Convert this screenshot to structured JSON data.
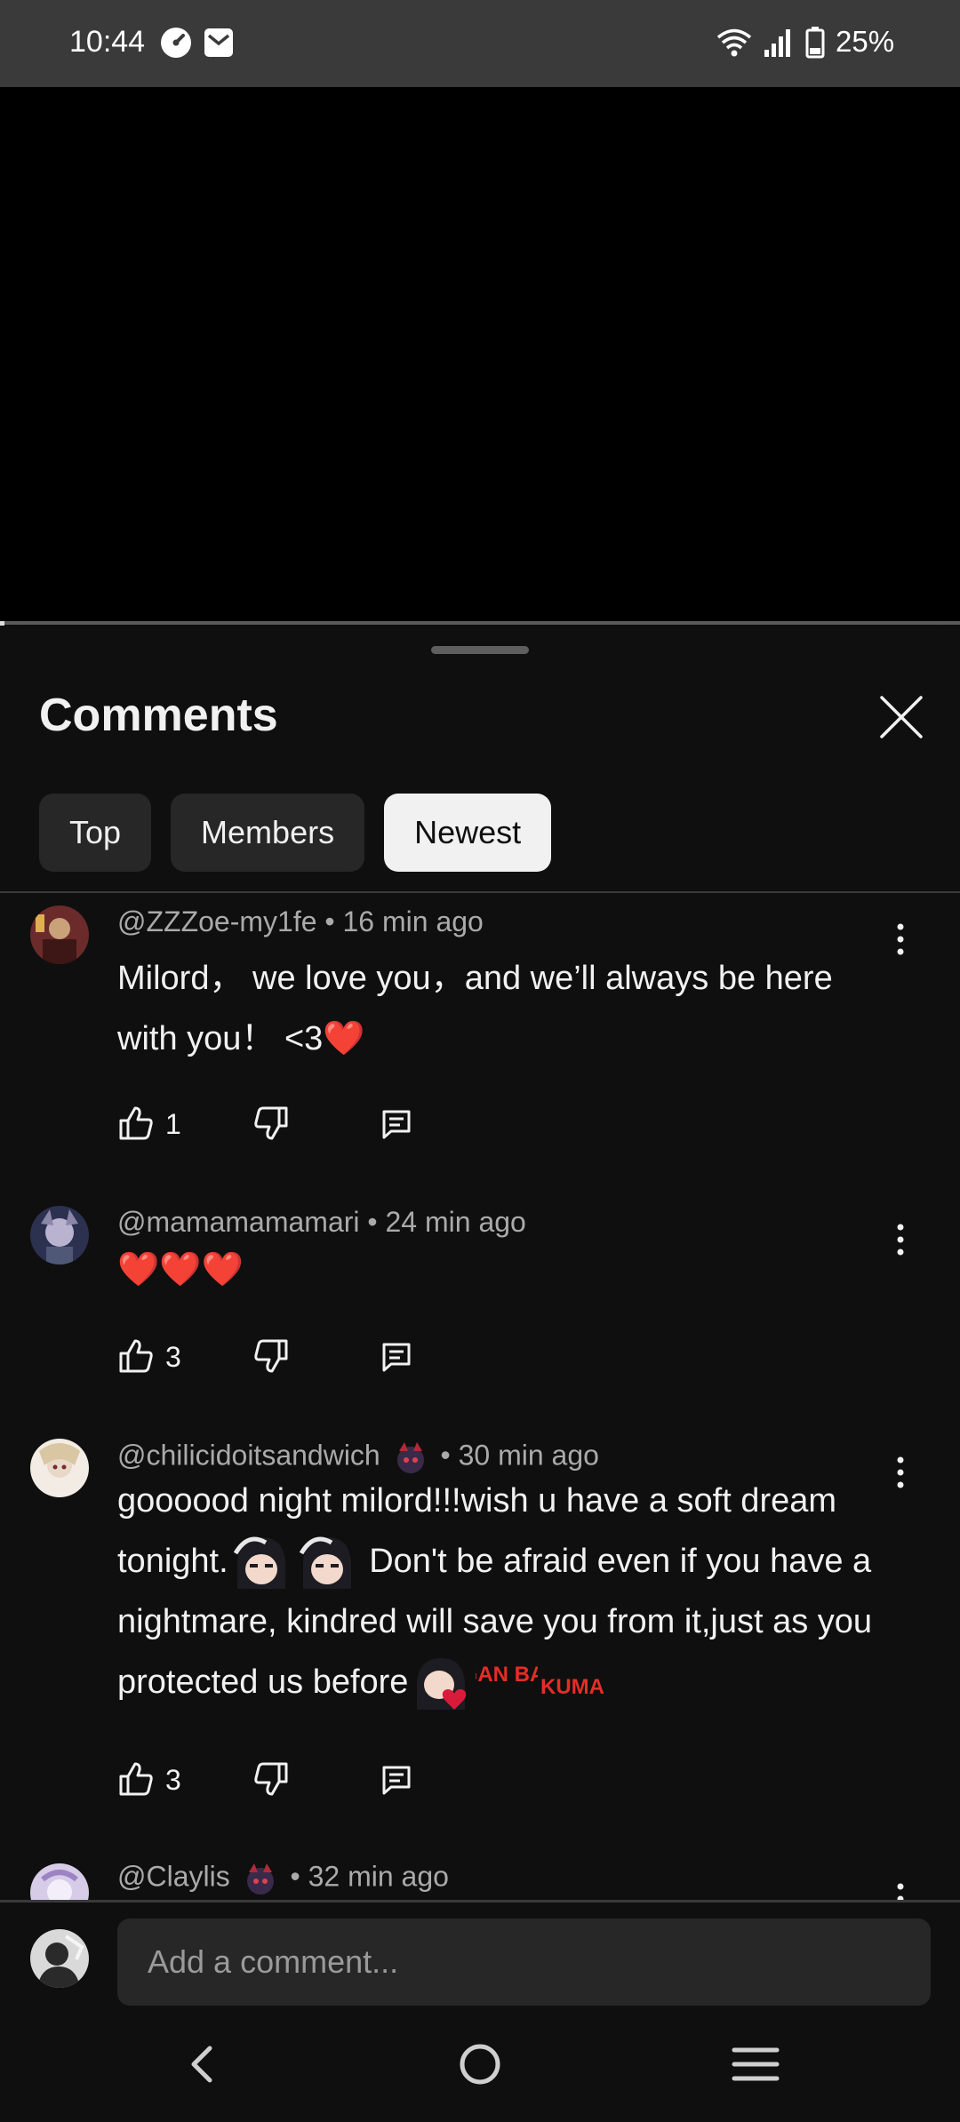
{
  "status_bar": {
    "time": "10:44",
    "battery_percent": "25%",
    "icons": [
      "speedometer-icon",
      "email-icon",
      "wifi-icon",
      "signal-icon",
      "battery-icon"
    ]
  },
  "comments_sheet": {
    "title": "Comments",
    "filter_chips": [
      {
        "label": "Top",
        "selected": false
      },
      {
        "label": "Members",
        "selected": false
      },
      {
        "label": "Newest",
        "selected": true
      }
    ]
  },
  "comments": [
    {
      "author": "@ZZZoe-my1fe",
      "time": "16 min ago",
      "text_1": "Milord， we love you，and we’ll always be here with you！ <3",
      "heart": "❤️",
      "likes": "1"
    },
    {
      "author": "@mamamamamari",
      "time": "24 min ago",
      "text_1": "❤️❤️❤️",
      "likes": "3"
    },
    {
      "author": "@chilicidoitsandwich",
      "time": "30 min ago",
      "text_1": "goooood night milord!!!wish u have a soft dream tonight.",
      "text_2": " Don't be afraid even if you have a nightmare, kindred will save you from it,just as you protected us before",
      "emote_labels": [
        "GAN BA!",
        "KUMA"
      ],
      "likes": "3"
    },
    {
      "author": "@Claylis",
      "time": "32 min ago"
    }
  ],
  "composer": {
    "placeholder": "Add a comment..."
  },
  "colors": {
    "background": "#0f0f0f",
    "chip": "#272727",
    "chip_selected": "#f1f1f1",
    "meta_text": "#aaaaaa",
    "heart": "#e53935"
  }
}
